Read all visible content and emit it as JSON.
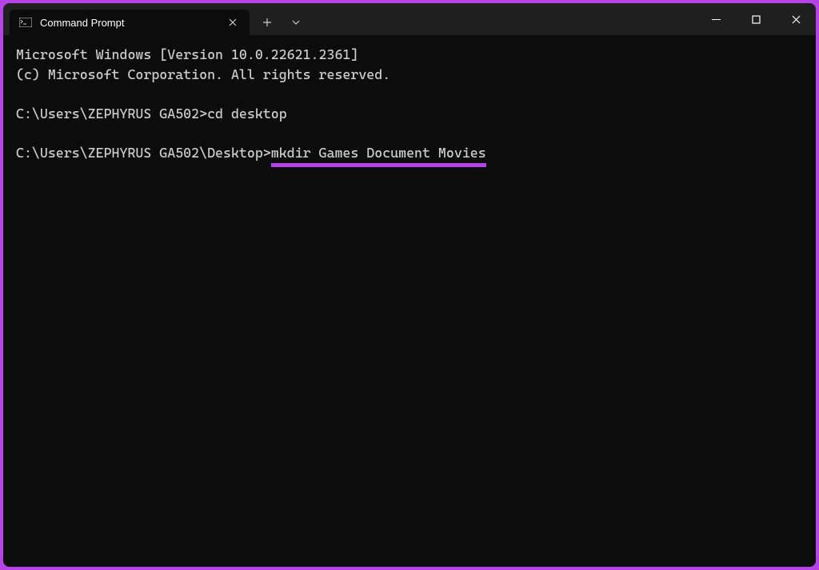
{
  "window": {
    "tab_title": "Command Prompt"
  },
  "terminal": {
    "line1": "Microsoft Windows [Version 10.0.22621.2361]",
    "line2": "(c) Microsoft Corporation. All rights reserved.",
    "prompt1": "C:\\Users\\ZEPHYRUS GA502>",
    "command1": "cd desktop",
    "prompt2": "C:\\Users\\ZEPHYRUS GA502\\Desktop>",
    "command2": "mkdir Games Document Movies"
  }
}
